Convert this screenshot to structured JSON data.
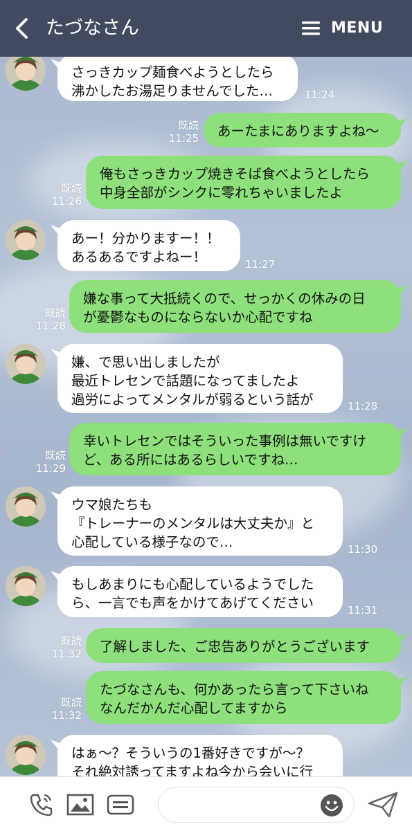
{
  "header": {
    "title": "たづなさん",
    "menu_label": "MENU"
  },
  "messages": [
    {
      "side": "in",
      "text": "さっきカップ麺食べようとしたら\n沸かしたお湯足りませんでした…",
      "time": "11:24"
    },
    {
      "side": "out",
      "text": "あーたまにありますよね～",
      "read": "既読",
      "time": "11:25"
    },
    {
      "side": "out",
      "text": "俺もさっきカップ焼きそば食べようとしたら\n中身全部がシンクに零れちゃいましたよ",
      "read": "既読",
      "time": "11:26"
    },
    {
      "side": "in",
      "text": "あー！分かりますー！！\nあるあるですよねー！",
      "time": "11:27"
    },
    {
      "side": "out",
      "text": "嫌な事って大抵続くので、せっかくの休みの日\nが憂鬱なものにならないか心配ですね",
      "read": "既読",
      "time": "11:28"
    },
    {
      "side": "in",
      "text": "嫌、で思い出しましたが\n最近トレセンで話題になってましたよ\n過労によってメンタルが弱るという話が",
      "time": "11:28"
    },
    {
      "side": "out",
      "text": "幸いトレセンではそういった事例は無いですけ\nど、ある所にはあるらしいですね…",
      "read": "既読",
      "time": "11:29"
    },
    {
      "side": "in",
      "text": "ウマ娘たちも\n『トレーナーのメンタルは大丈夫か』と\n心配している様子なので…",
      "time": "11:30"
    },
    {
      "side": "in",
      "text": "もしあまりにも心配しているようでした\nら、一言でも声をかけてあげてください",
      "time": "11:31"
    },
    {
      "side": "out",
      "text": "了解しました、ご忠告ありがとうございます",
      "read": "既読",
      "time": "11:32"
    },
    {
      "side": "out",
      "text": "たづなさんも、何かあったら言って下さいね\nなんだかんだ心配してますから",
      "read": "既読",
      "time": "11:32"
    },
    {
      "side": "in",
      "text": "はぁ～？そういうの1番好きですが～？\nそれ絶対誘ってますよね今から会いに行",
      "time": ""
    }
  ],
  "composer": {
    "placeholder": ""
  },
  "icons": {
    "back": "chevron-left-icon",
    "menu": "hamburger-icon",
    "call": "phone-icon",
    "image": "image-icon",
    "keyboard": "keyboard-icon",
    "emoji": "smiley-icon",
    "send": "send-icon"
  },
  "colors": {
    "header": "#414a5e",
    "outgoing": "#8de07b",
    "incoming": "#ffffff",
    "background": "#b0bfd4"
  }
}
